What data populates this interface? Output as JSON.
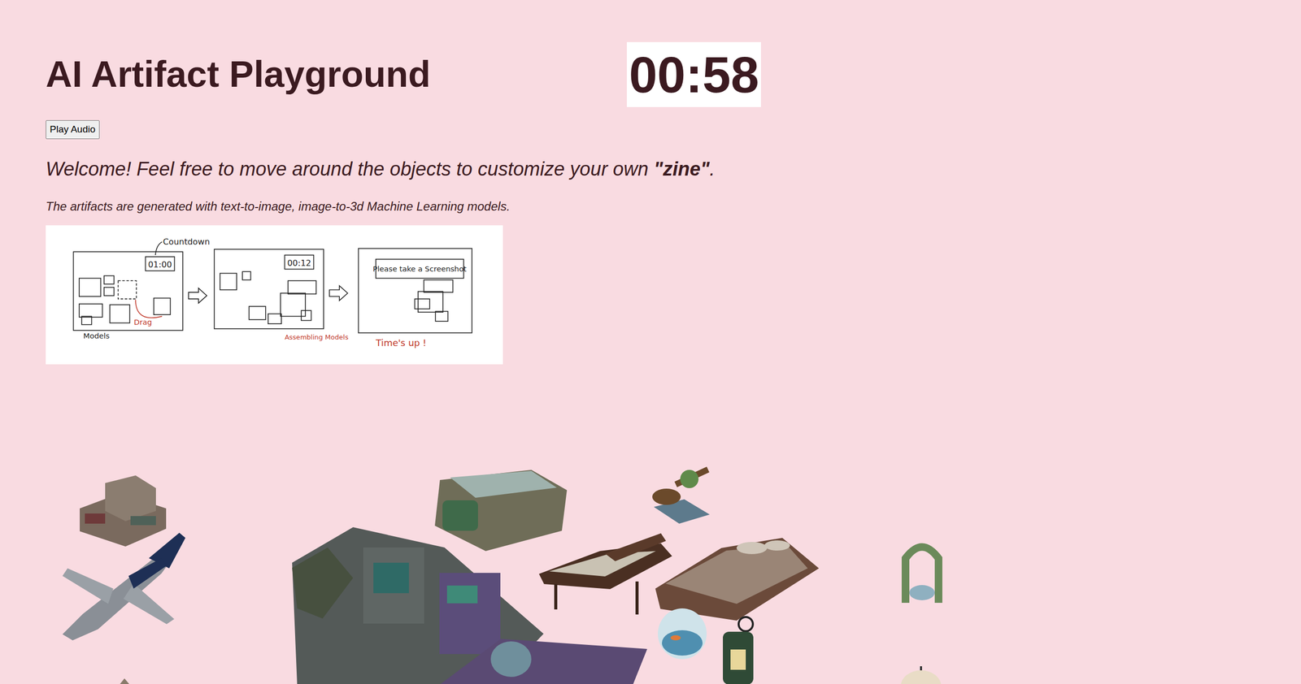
{
  "title": "AI Artifact Playground",
  "timer": "00:58",
  "audio_button": "Play Audio",
  "welcome": {
    "before": "Welcome! Feel free to move around the objects to customize your own ",
    "emphasis": "\"zine\"",
    "after": "."
  },
  "note": "The artifacts are generated with text-to-image, image-to-3d Machine Learning models.",
  "instructions": {
    "countdown_label": "Countdown",
    "start_time": "01:00",
    "drag_label": "Drag",
    "models_label": "Models",
    "mid_time": "00:12",
    "assembling_label": "Assembling Models",
    "screenshot_prompt": "Please take a Screenshot",
    "times_up": "Time's up !"
  }
}
